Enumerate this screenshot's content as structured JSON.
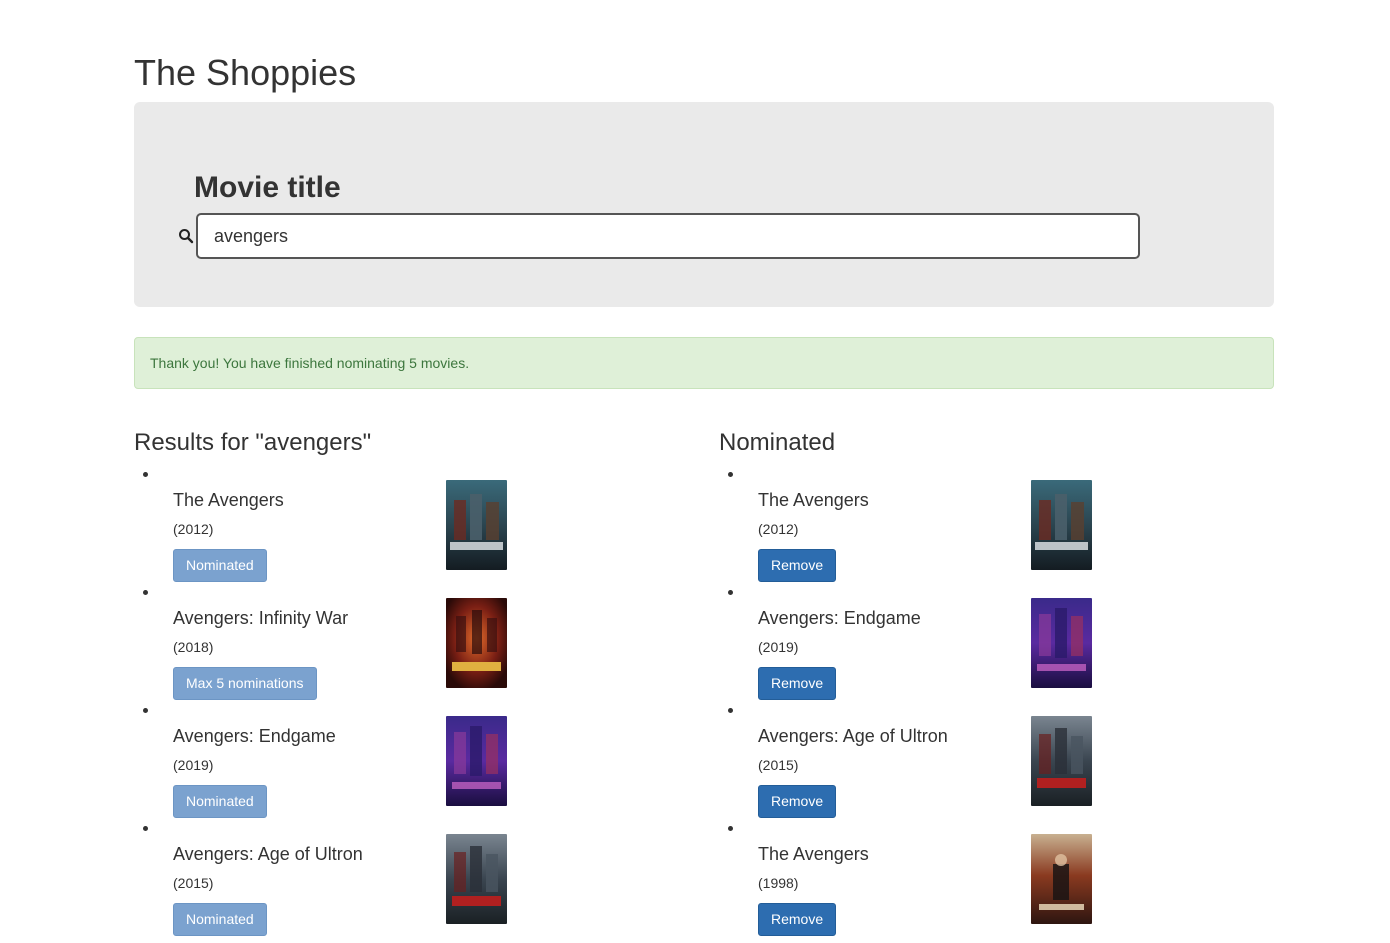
{
  "app": {
    "title": "The Shoppies"
  },
  "search": {
    "label": "Movie title",
    "value": "avengers",
    "icon": "search-icon"
  },
  "alert": {
    "message": "Thank you! You have finished nominating 5 movies."
  },
  "results": {
    "heading": "Results for \"avengers\"",
    "items": [
      {
        "title": "The Avengers",
        "year": "(2012)",
        "button": "Nominated",
        "button_state": "disabled"
      },
      {
        "title": "Avengers: Infinity War",
        "year": "(2018)",
        "button": "Max 5 nominations",
        "button_state": "disabled"
      },
      {
        "title": "Avengers: Endgame",
        "year": "(2019)",
        "button": "Nominated",
        "button_state": "disabled"
      },
      {
        "title": "Avengers: Age of Ultron",
        "year": "(2015)",
        "button": "Nominated",
        "button_state": "disabled"
      }
    ]
  },
  "nominated": {
    "heading": "Nominated",
    "items": [
      {
        "title": "The Avengers",
        "year": "(2012)",
        "button": "Remove"
      },
      {
        "title": "Avengers: Endgame",
        "year": "(2019)",
        "button": "Remove"
      },
      {
        "title": "Avengers: Age of Ultron",
        "year": "(2015)",
        "button": "Remove"
      },
      {
        "title": "The Avengers",
        "year": "(1998)",
        "button": "Remove"
      }
    ]
  },
  "colors": {
    "panel_bg": "#eaeaea",
    "alert_bg": "#dff0d8",
    "alert_text": "#3c763d",
    "button_primary": "#2d6db0",
    "button_disabled": "#7ba2cf"
  }
}
